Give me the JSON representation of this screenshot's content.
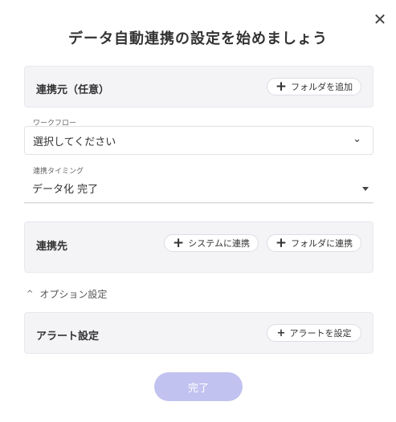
{
  "dialog": {
    "title": "データ自動連携の設定を始めましょう",
    "close_icon": "✕"
  },
  "source": {
    "label": "連携元（任意）",
    "add_folder_label": "フォルダを追加"
  },
  "workflow": {
    "label": "ワークフロー",
    "value": "選択してください"
  },
  "timing": {
    "label": "連携タイミング",
    "value": "データ化 完了"
  },
  "destination": {
    "label": "連携先",
    "system_label": "システムに連携",
    "folder_label": "フォルダに連携"
  },
  "options": {
    "label": "オプション設定"
  },
  "alert": {
    "label": "アラート設定",
    "button_label": "アラートを設定"
  },
  "footer": {
    "done_label": "完了"
  },
  "icons": {
    "plus": "+",
    "chevron_down": "⌄",
    "chevron_up": "^"
  },
  "colors": {
    "primary_disabled": "#c2c2f0",
    "panel_bg": "#f4f4f7"
  }
}
